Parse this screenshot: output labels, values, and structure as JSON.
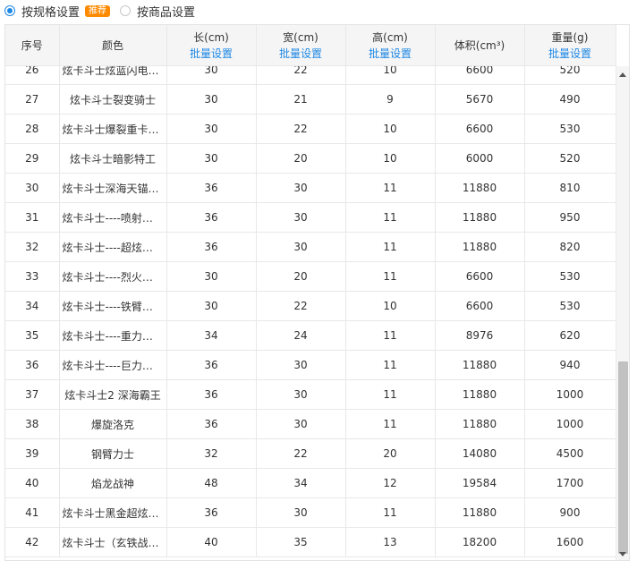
{
  "mode": {
    "option_spec_label": "按规格设置",
    "option_spec_badge": "推荐",
    "option_product_label": "按商品设置",
    "selected": "spec"
  },
  "table": {
    "headers": {
      "index": "序号",
      "color": "颜色",
      "length": "长(cm)",
      "width": "宽(cm)",
      "height": "高(cm)",
      "volume": "体积(cm³)",
      "weight": "重量(g)",
      "batch_label": "批量设置"
    },
    "rows": [
      {
        "index": "26",
        "color": "炫卡斗士炫蓝闪电战神",
        "length": "30",
        "width": "22",
        "height": "10",
        "volume": "6600",
        "weight": "520"
      },
      {
        "index": "27",
        "color": "炫卡斗士裂变骑士",
        "length": "30",
        "width": "21",
        "height": "9",
        "volume": "5670",
        "weight": "490"
      },
      {
        "index": "28",
        "color": "炫卡斗士爆裂重卡战神",
        "length": "30",
        "width": "22",
        "height": "10",
        "volume": "6600",
        "weight": "530"
      },
      {
        "index": "29",
        "color": "炫卡斗士暗影特工",
        "length": "30",
        "width": "20",
        "height": "10",
        "volume": "6000",
        "weight": "520"
      },
      {
        "index": "30",
        "color": "炫卡斗士深海天锚战神",
        "length": "36",
        "width": "30",
        "height": "11",
        "volume": "11880",
        "weight": "810"
      },
      {
        "index": "31",
        "color": "炫卡斗士----喷射加速战神",
        "length": "36",
        "width": "30",
        "height": "11",
        "volume": "11880",
        "weight": "950"
      },
      {
        "index": "32",
        "color": "炫卡斗士----超炫电光战神",
        "length": "36",
        "width": "30",
        "height": "11",
        "volume": "11880",
        "weight": "820"
      },
      {
        "index": "33",
        "color": "炫卡斗士----烈火修罗战神",
        "length": "30",
        "width": "20",
        "height": "11",
        "volume": "6600",
        "weight": "530"
      },
      {
        "index": "34",
        "color": "炫卡斗士----铁臂战神",
        "length": "30",
        "width": "22",
        "height": "10",
        "volume": "6600",
        "weight": "530"
      },
      {
        "index": "35",
        "color": "炫卡斗士----重力战神",
        "length": "34",
        "width": "24",
        "height": "11",
        "volume": "8976",
        "weight": "620"
      },
      {
        "index": "36",
        "color": "炫卡斗士----巨力战神",
        "length": "36",
        "width": "30",
        "height": "11",
        "volume": "11880",
        "weight": "940"
      },
      {
        "index": "37",
        "color": "炫卡斗士2 深海霸王",
        "length": "36",
        "width": "30",
        "height": "11",
        "volume": "11880",
        "weight": "1000"
      },
      {
        "index": "38",
        "color": "爆旋洛克",
        "length": "36",
        "width": "30",
        "height": "11",
        "volume": "11880",
        "weight": "1000"
      },
      {
        "index": "39",
        "color": "钢臂力士",
        "length": "32",
        "width": "22",
        "height": "20",
        "volume": "14080",
        "weight": "4500"
      },
      {
        "index": "40",
        "color": "焰龙战神",
        "length": "48",
        "width": "34",
        "height": "12",
        "volume": "19584",
        "weight": "1700"
      },
      {
        "index": "41",
        "color": "炫卡斗士黑金超炫战神",
        "length": "36",
        "width": "30",
        "height": "11",
        "volume": "11880",
        "weight": "900"
      },
      {
        "index": "42",
        "color": "炫卡斗士（玄铁战神）",
        "length": "40",
        "width": "35",
        "height": "13",
        "volume": "18200",
        "weight": "1600"
      }
    ]
  },
  "colors": {
    "accent": "#1e88e5",
    "badge": "#ff8a00",
    "header_bg": "#f5f5f5"
  }
}
